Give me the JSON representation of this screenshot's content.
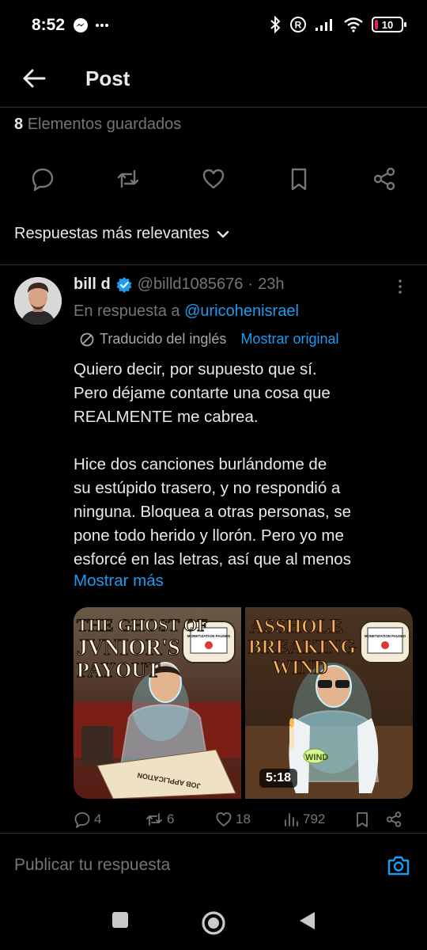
{
  "status_bar": {
    "time": "8:52",
    "battery": "10"
  },
  "header": {
    "title": "Post"
  },
  "saved": {
    "count": "8",
    "label": "Elementos guardados"
  },
  "filter": {
    "label": "Respuestas más relevantes"
  },
  "reply": {
    "name": "bill d",
    "handle": "@billd1085676",
    "separator": "·",
    "time": "23h",
    "reply_to_prefix": "En respuesta a",
    "reply_to_user": "@uricohenisrael",
    "translated_label": "Traducido del inglés",
    "show_original": "Mostrar original",
    "body_lines": [
      "Quiero decir, por supuesto que sí.",
      "Pero déjame contarte una cosa que",
      "REALMENTE me cabrea.",
      "",
      "Hice dos canciones burlándome de",
      "su estúpido trasero, y no respondió a",
      "ninguna. Bloquea a otras personas, se",
      "pone todo herido y llorón. Pero yo me",
      "esforcé en las letras, así que al menos"
    ],
    "show_more": "Mostrar más",
    "media": [
      {
        "title_lines": [
          "THE GHOST OF",
          "JVNIOR'S",
          "PAYOUT"
        ],
        "sign_text": "MONETIZATION PAUSED",
        "paper_text": "JOB APPLICATION"
      },
      {
        "title_lines": [
          "ASSHOLE",
          "BREAKING",
          "WIND"
        ],
        "sign_text": "MONETIZATION PAUSED",
        "wind_text": "WIND",
        "duration": "5:18"
      }
    ],
    "metrics": {
      "replies": "4",
      "reposts": "6",
      "likes": "18",
      "views": "792"
    }
  },
  "compose": {
    "placeholder": "Publicar tu respuesta"
  },
  "colors": {
    "accent": "#1d9bf0",
    "muted": "#71767b",
    "text": "#e7e9ea",
    "divider": "#2f3336"
  },
  "icons": [
    "back-arrow-icon",
    "reply-icon",
    "repost-icon",
    "like-icon",
    "bookmark-icon",
    "share-icon",
    "chevron-down-icon",
    "verified-badge-icon",
    "more-vertical-icon",
    "translate-icon",
    "views-icon",
    "camera-icon"
  ]
}
